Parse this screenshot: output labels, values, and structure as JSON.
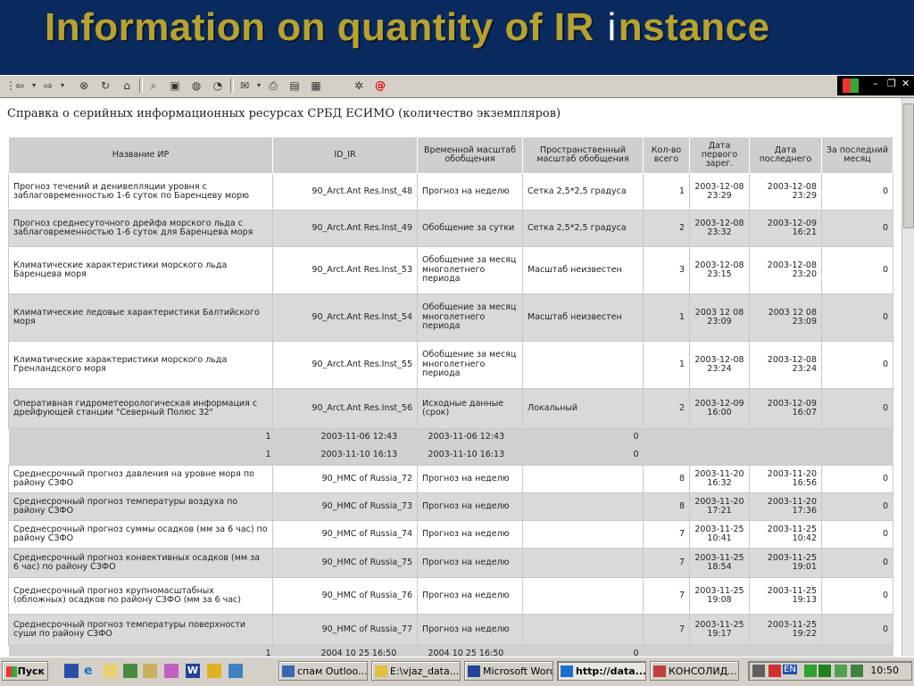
{
  "slide": {
    "title_part1": "Information on quantity of IR ",
    "title_i": "i",
    "title_part2": "nstance"
  },
  "colors": {
    "title_bg": "#0a2a5e",
    "title_text": "#b7a22e",
    "header_gray": "#cfcfcf",
    "row_gray": "#d9d9d9"
  },
  "toolbar": {
    "icons": [
      "back-icon",
      "forward-icon",
      "stop-icon",
      "refresh-icon",
      "home-icon",
      "search-icon",
      "favorites-icon",
      "history-icon",
      "channels-icon",
      "mail-icon",
      "print-icon",
      "edit-icon",
      "settings-icon"
    ],
    "at_symbol": "@"
  },
  "page": {
    "heading": "Справка о серийных информационных ресурсах СРБД ЕСИМО (количество экземпляров)"
  },
  "table": {
    "headers": [
      "Название ИР",
      "ID_IR",
      "Временной масштаб обобщения",
      "Пространственный масштаб обобщения",
      "Кол-во всего",
      "Дата первого зарег.",
      "Дата последнего",
      "За последний месяц"
    ],
    "rows": [
      {
        "name": "Прогноз течений и денивелляции уровня с заблаговременностью 1-6 суток по Баренцеву морю",
        "id": "90_Arct.Ant Res.Inst_48",
        "time": "Прогноз на неделю",
        "space": "Сетка 2,5*2,5 градуса",
        "count": "1",
        "first": "2003-12-08 23:29",
        "last": "2003-12-08 23:29",
        "month": "0"
      },
      {
        "name": "Прогноз среднесуточного дрейфа морского льда с заблаговременностью 1-6 суток для Баренцева моря",
        "id": "90_Arct.Ant Res.Inst_49",
        "time": "Обобщение за сутки",
        "space": "Сетка 2,5*2,5 градуса",
        "count": "2",
        "first": "2003-12-08 23:32",
        "last": "2003-12-09 16:21",
        "month": "0"
      },
      {
        "name": "Климатические характеристики морского льда Баренцева моря",
        "id": "90_Arct.Ant Res.Inst_53",
        "time": "Обобщение за месяц многолетнего периода",
        "space": "Масштаб неизвестен",
        "count": "3",
        "first": "2003-12-08 23:15",
        "last": "2003-12-08 23:20",
        "month": "0"
      },
      {
        "name": "Климатические ледовые характеристики Балтийского моря",
        "id": "90_Arct.Ant Res.Inst_54",
        "time": "Обобщение за месяц многолетнего периода",
        "space": "Масштаб неизвестен",
        "count": "1",
        "first": "2003 12 08 23:09",
        "last": "2003 12 08 23:09",
        "month": "0"
      },
      {
        "name": "Климатические характеристики морского льда Гренландского моря",
        "id": "90_Arct.Ant Res.Inst_55",
        "time": "Обобщение за месяц многолетнего периода",
        "space": "",
        "count": "1",
        "first": "2003-12-08 23:24",
        "last": "2003-12-08 23:24",
        "month": "0"
      },
      {
        "name": "Оперативная гидрометеорологическая информация с дрейфующей станции \"Северный Полюс 32\"",
        "id": "90_Arct.Ant Res.Inst_56",
        "time": "Исходные данные (срок)",
        "space": "Локальный",
        "count": "2",
        "first": "2003-12-09 16:00",
        "last": "2003-12-09 16:07",
        "month": "0"
      }
    ],
    "sub_rows": [
      {
        "n": "1",
        "a": "2003-11-06 12:43",
        "b": "2003-11-06 12:43",
        "c": "0"
      },
      {
        "n": "1",
        "a": "2003-11-10 16:13",
        "b": "2003-11-10 16:13",
        "c": "0"
      }
    ],
    "rows2": [
      {
        "name": "Среднесрочный прогноз давления на уровне моря по району СЗФО",
        "id": "90_HMC of Russia_72",
        "time": "Прогноз на неделю",
        "space": "",
        "count": "8",
        "first": "2003-11-20 16:32",
        "last": "2003-11-20 16:56",
        "month": "0"
      },
      {
        "name": "Среднесрочный прогноз температуры воздуха по району СЗФО",
        "id": "90_HMC of Russia_73",
        "time": "Прогноз на неделю",
        "space": "",
        "count": "8",
        "first": "2003-11-20 17:21",
        "last": "2003-11-20 17:36",
        "month": "0"
      },
      {
        "name": "Среднесрочный прогноз суммы осадков (мм за 6 час) по району СЗФО",
        "id": "90_HMC of Russia_74",
        "time": "Прогноз на неделю",
        "space": "",
        "count": "7",
        "first": "2003-11-25 10:41",
        "last": "2003-11-25 10:42",
        "month": "0"
      },
      {
        "name": "Среднесрочный прогноз конвективных осадков (мм за 6 час) по району СЗФО",
        "id": "90_HMC of Russia_75",
        "time": "Прогноз на неделю",
        "space": "",
        "count": "7",
        "first": "2003-11-25 18:54",
        "last": "2003-11-25 19:01",
        "month": "0"
      },
      {
        "name": "Среднесрочный прогноз крупномасштабных (обложных) осадков по району СЗФО (мм за 6 час)",
        "id": "90_HMC of Russia_76",
        "time": "Прогноз на неделю",
        "space": "",
        "count": "7",
        "first": "2003-11-25 19:08",
        "last": "2003-11-25 19:13",
        "month": "0"
      },
      {
        "name": "Среднесрочный прогноз температуры поверхности суши по району СЗФО",
        "id": "90_HMC of Russia_77",
        "time": "Прогноз на неделю",
        "space": "",
        "count": "7",
        "first": "2003-11-25 19:17",
        "last": "2003-11-25 19:22",
        "month": "0"
      }
    ],
    "sub_rows2": [
      {
        "n": "1",
        "a": "2004 10 25 16:50",
        "b": "2004 10 25 16:50",
        "c": "0"
      }
    ]
  },
  "taskbar": {
    "start_label": "Пуск",
    "quicklaunch": [
      "save-icon",
      "ie-icon",
      "outlook-icon",
      "network-icon",
      "find-icon",
      "paint-icon",
      "word-icon",
      "media-icon",
      "explorer-icon"
    ],
    "tasks": [
      {
        "label": "спам  Outloo...",
        "icon": "outlook-icon"
      },
      {
        "label": "E:\\vjaz_data...",
        "icon": "folder-icon"
      },
      {
        "label": "Microsoft Word",
        "icon": "word-icon"
      },
      {
        "label": "http://data....",
        "icon": "ie-icon"
      },
      {
        "label": "КОНСОЛИД...",
        "icon": "document-icon"
      }
    ],
    "lang": "EN",
    "clock": "10:50"
  }
}
